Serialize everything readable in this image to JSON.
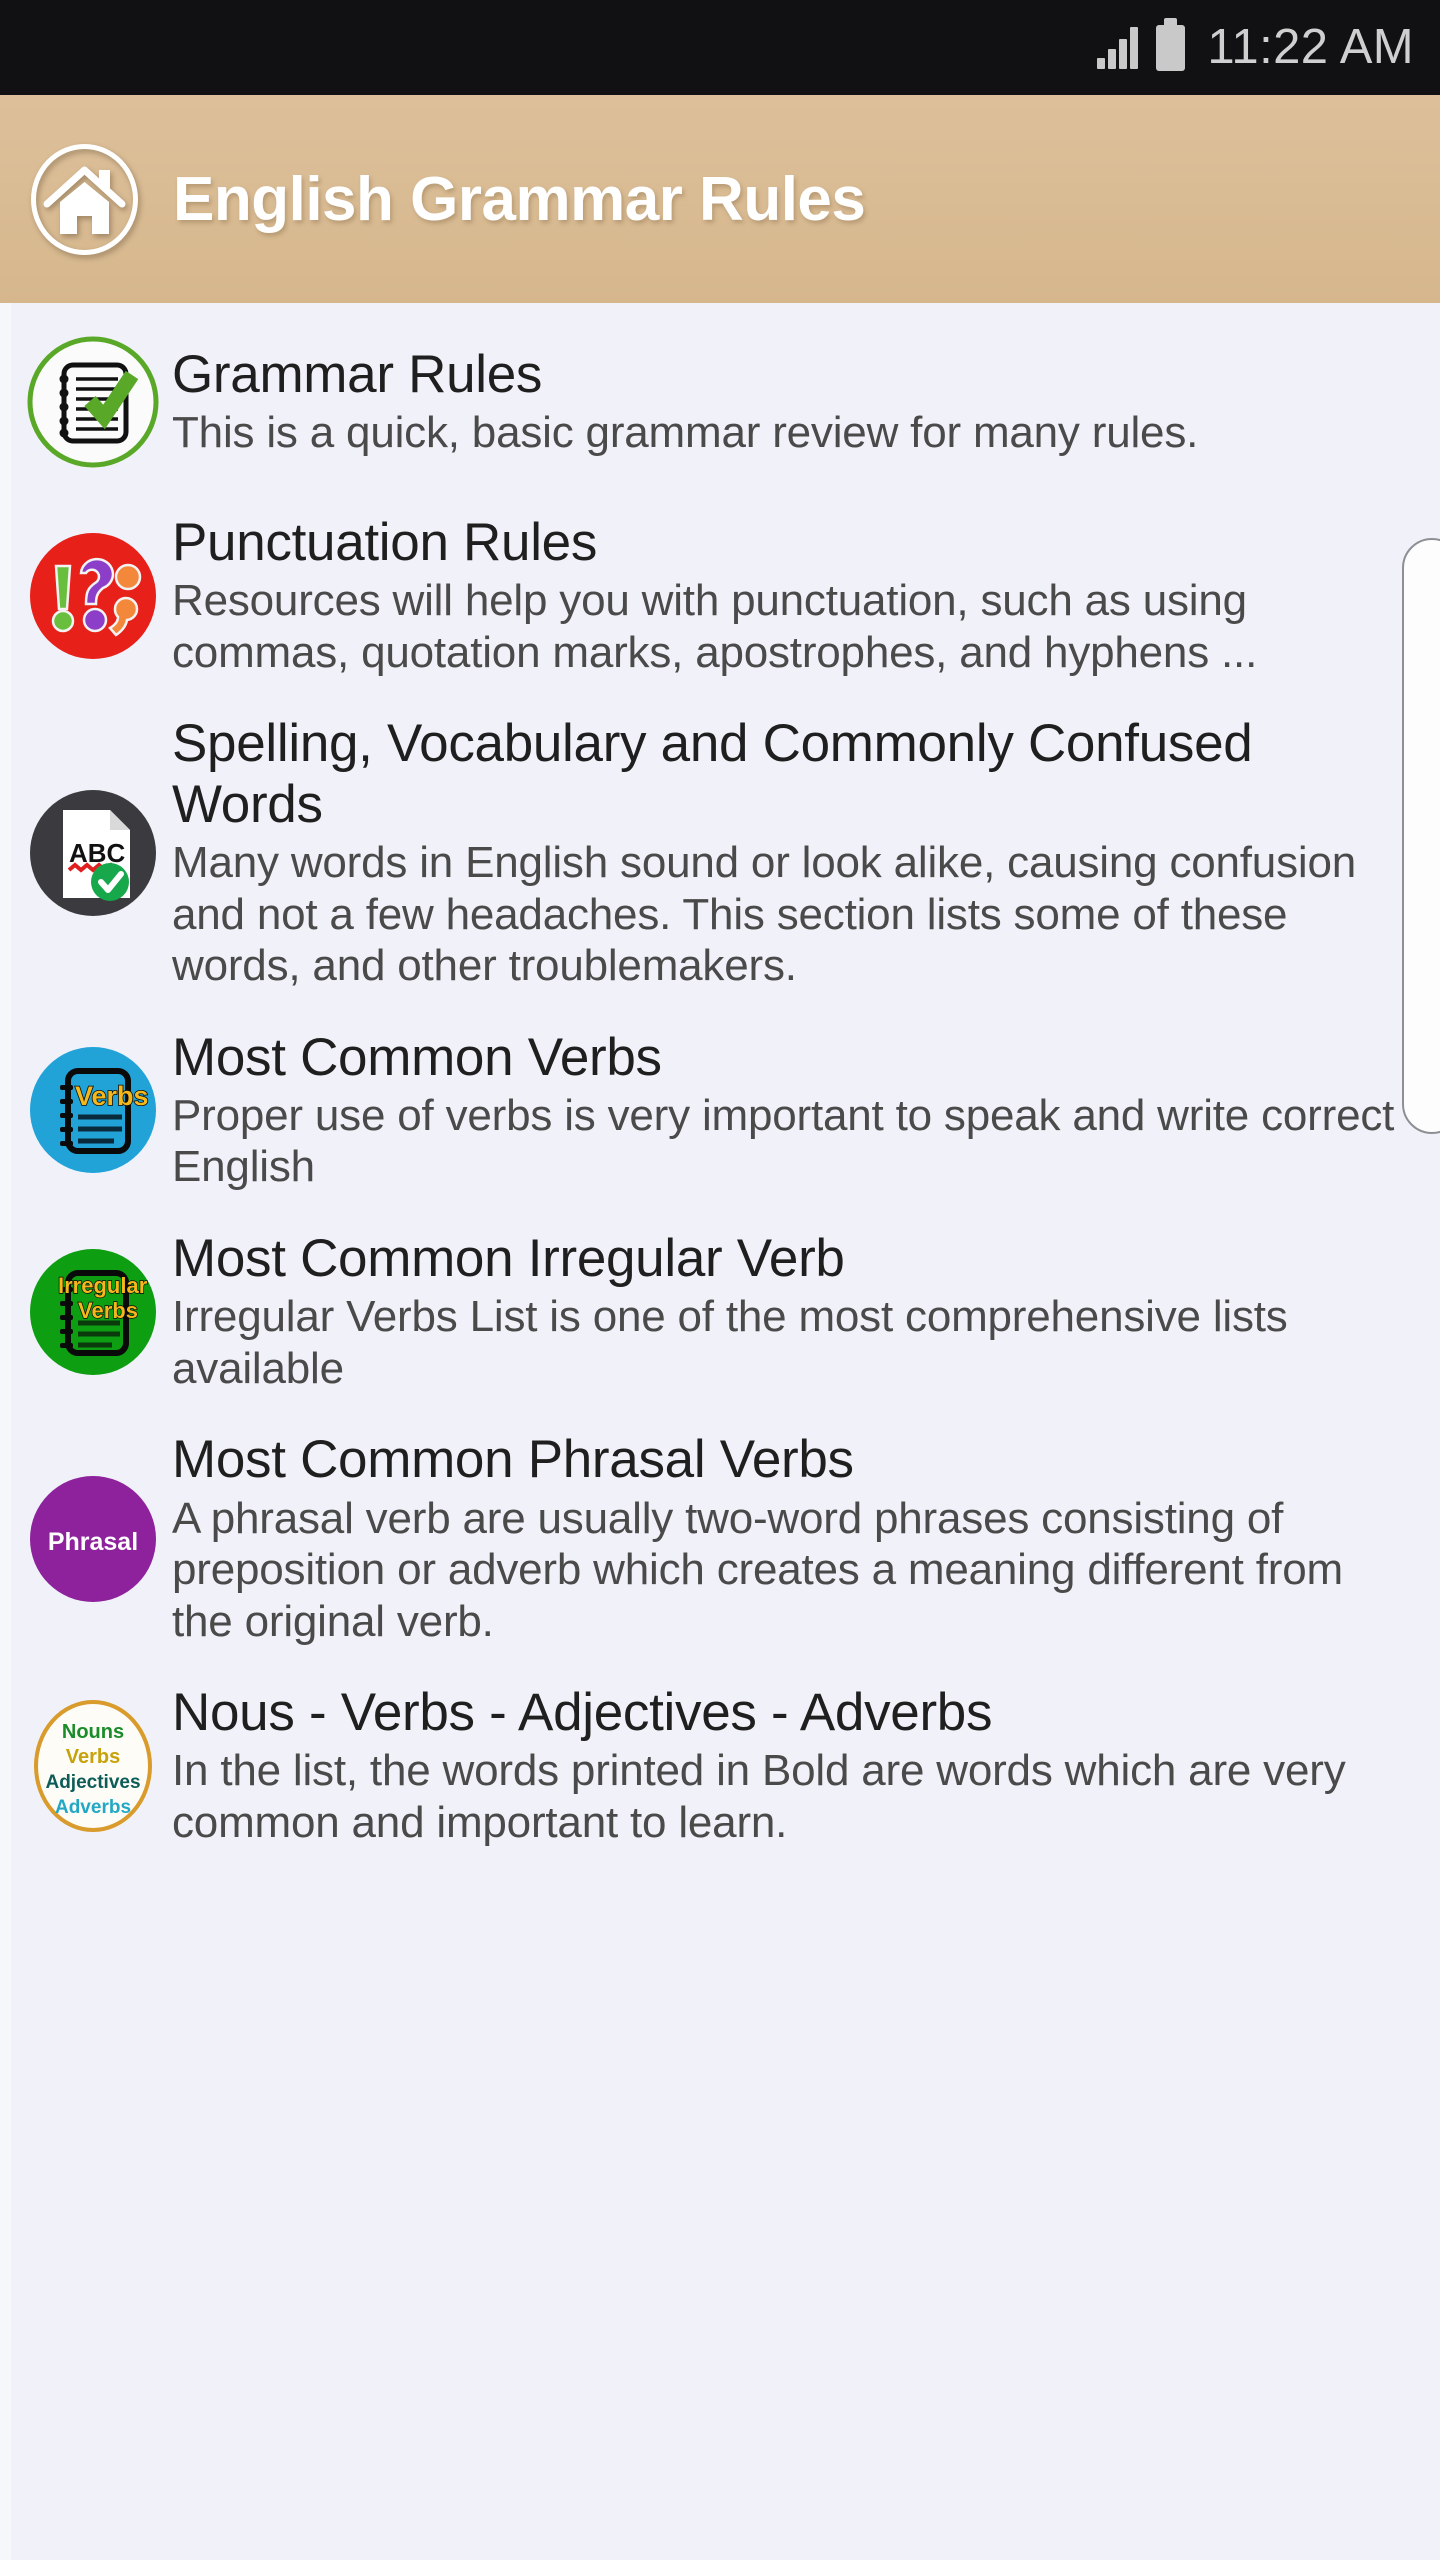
{
  "status_bar": {
    "time": "11:22 AM",
    "signal_icon": "signal-bars-icon",
    "battery_icon": "battery-full-icon"
  },
  "header": {
    "title": "English Grammar Rules",
    "home_icon": "home-icon",
    "background_color": "#d9bb93",
    "title_color": "#ffffff"
  },
  "list": {
    "background_color": "#f1f2f9",
    "items": [
      {
        "title": "Grammar Rules",
        "description": "This is a quick, basic grammar review for many rules.",
        "icon": "notepad-check-icon",
        "icon_color": "#5aa828"
      },
      {
        "title": "Punctuation Rules",
        "description": "Resources will help you with punctuation, such as using commas, quotation marks, apostrophes, and hyphens ...",
        "icon": "punctuation-marks-icon",
        "icon_color": "#e8201a"
      },
      {
        "title": "Spelling, Vocabulary and Commonly Confused Words",
        "description": "Many words in English sound or look alike, causing confusion and not a few headaches. This section lists some of these words, and other troublemakers.",
        "icon": "abc-spellcheck-document-icon",
        "icon_color": "#3b3b3f"
      },
      {
        "title": "Most Common Verbs",
        "description": "Proper use of verbs is very important to speak and write correct English",
        "icon": "verbs-notepad-icon",
        "icon_color": "#21a3d8",
        "icon_label": "Verbs"
      },
      {
        "title": "Most Common Irregular Verb",
        "description": "Irregular Verbs List is one of the most comprehensive lists available",
        "icon": "irregular-verbs-notepad-icon",
        "icon_color": "#0e9e12",
        "icon_label_line1": "Irregular",
        "icon_label_line2": "Verbs"
      },
      {
        "title": "Most Common Phrasal Verbs",
        "description": "A phrasal verb are usually two-word phrases consisting of preposition or adverb which creates a meaning different from the original verb.",
        "icon": "phrasal-badge-icon",
        "icon_color": "#8d229c",
        "icon_label": "Phrasal"
      },
      {
        "title": "Nous - Verbs - Adjectives - Adverbs",
        "description": "In the list, the words printed in Bold are words which are very common and important to learn.",
        "icon": "parts-of-speech-icon",
        "icon_color": "#d99b2b",
        "icon_label_1": "Nouns",
        "icon_label_2": "Verbs",
        "icon_label_3": "Adjectives",
        "icon_label_4": "Adverbs"
      }
    ]
  },
  "scrollbar": {
    "name": "vertical-scrollbar"
  }
}
